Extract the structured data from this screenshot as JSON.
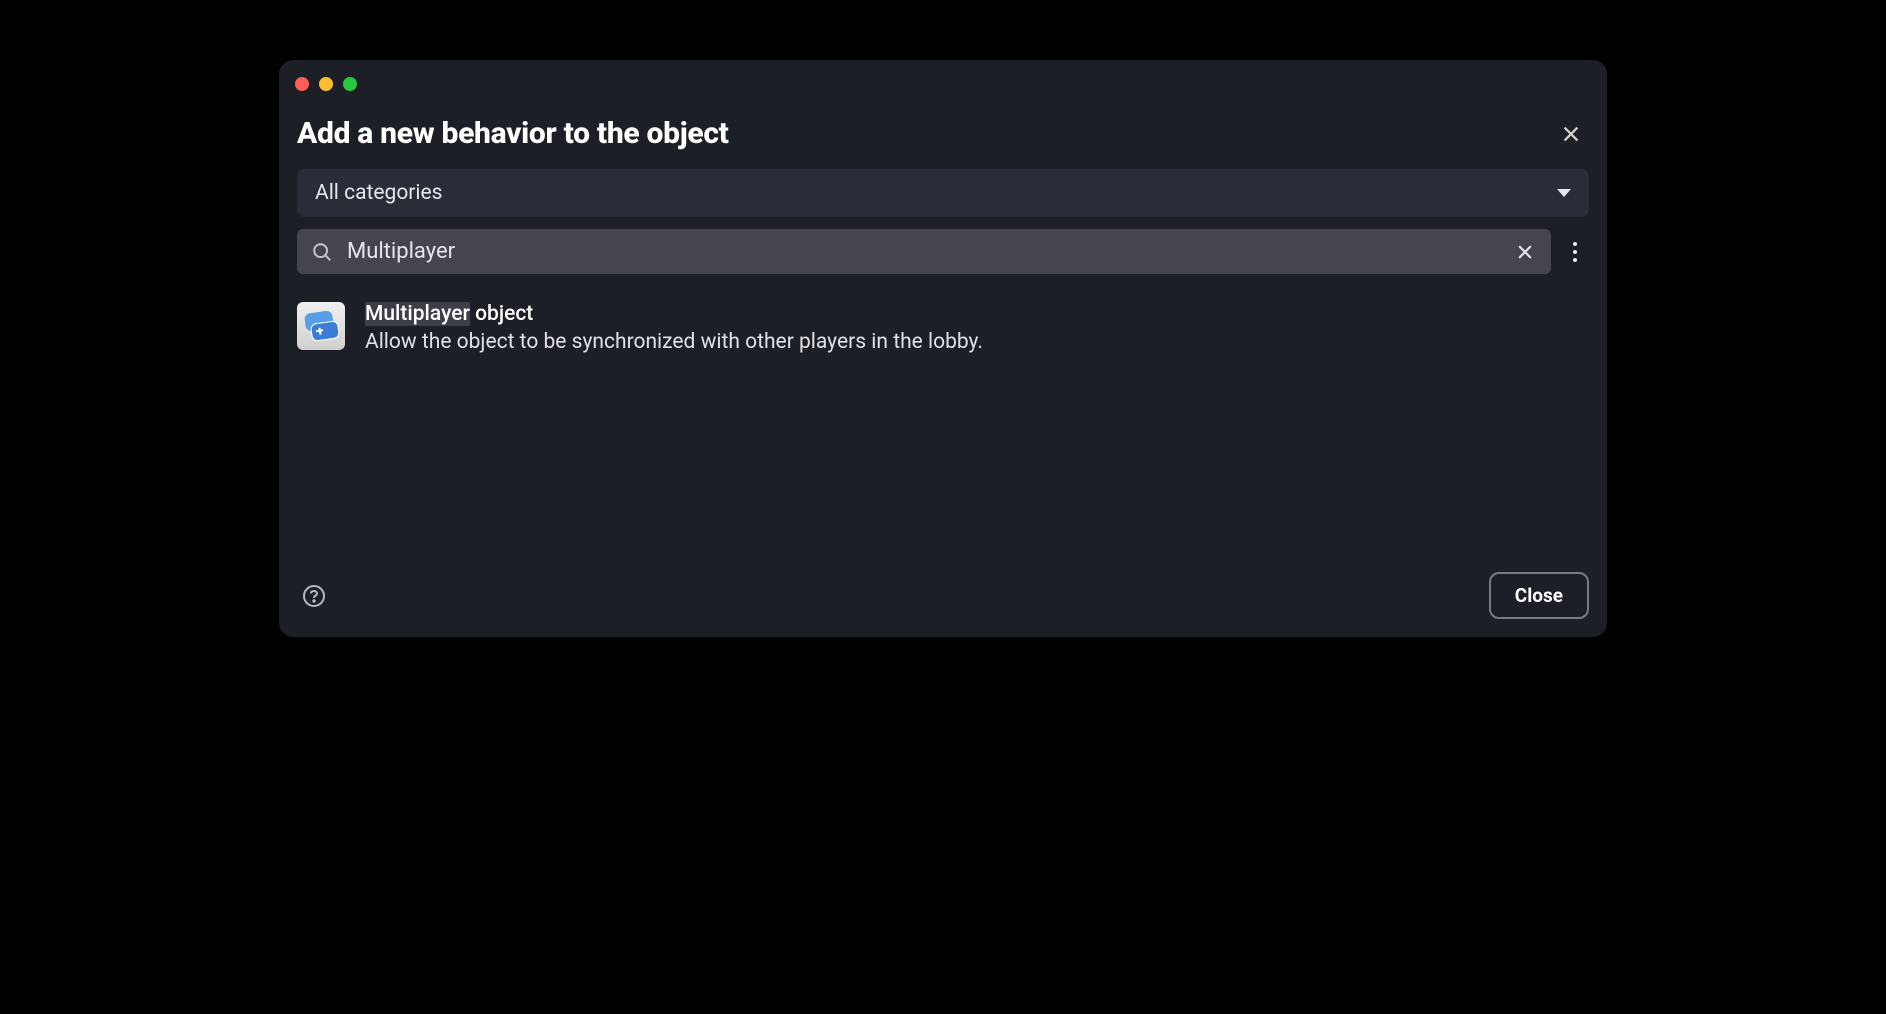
{
  "dialog": {
    "title": "Add a new behavior to the object"
  },
  "category": {
    "selected": "All categories"
  },
  "search": {
    "value": "Multiplayer"
  },
  "results": [
    {
      "title_highlight": "Multiplayer",
      "title_rest": " object",
      "description": "Allow the object to be synchronized with other players in the lobby.",
      "icon": "gamepad-multiplayer"
    }
  ],
  "footer": {
    "close_label": "Close"
  }
}
